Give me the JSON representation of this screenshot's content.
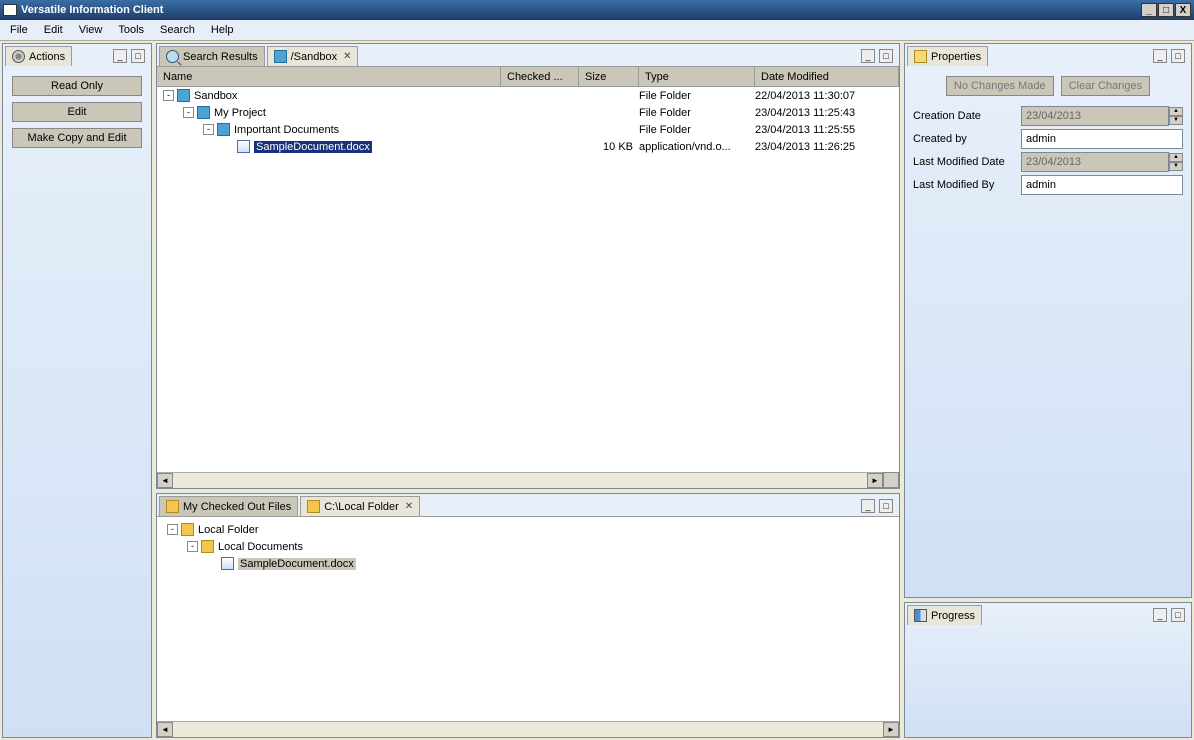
{
  "title": "Versatile Information Client",
  "menus": [
    "File",
    "Edit",
    "View",
    "Tools",
    "Search",
    "Help"
  ],
  "actions": {
    "title": "Actions",
    "buttons": [
      "Read Only",
      "Edit",
      "Make Copy and Edit"
    ]
  },
  "tabs": {
    "search": "Search Results",
    "sandbox": "/Sandbox"
  },
  "columns": {
    "name": "Name",
    "checked": "Checked ...",
    "size": "Size",
    "type": "Type",
    "date": "Date Modified"
  },
  "tree": [
    {
      "level": 1,
      "exp": "-",
      "icon": "folder",
      "name": "Sandbox",
      "size": "",
      "type": "File Folder",
      "date": "22/04/2013 11:30:07"
    },
    {
      "level": 2,
      "exp": "-",
      "icon": "folder",
      "name": "My Project",
      "size": "",
      "type": "File Folder",
      "date": "23/04/2013 11:25:43"
    },
    {
      "level": 3,
      "exp": "-",
      "icon": "folder",
      "name": "Important Documents",
      "size": "",
      "type": "File Folder",
      "date": "23/04/2013 11:25:55"
    },
    {
      "level": 4,
      "exp": "",
      "icon": "doc",
      "name": "SampleDocument.docx",
      "size": "10 KB",
      "type": "application/vnd.o...",
      "date": "23/04/2013 11:26:25",
      "selected": true
    }
  ],
  "local": {
    "tab_checked": "My Checked Out Files",
    "tab_path": "C:\\Local Folder",
    "tree": [
      {
        "level": 1,
        "exp": "-",
        "icon": "folder-y",
        "name": "Local Folder"
      },
      {
        "level": 2,
        "exp": "-",
        "icon": "folder-y",
        "name": "Local Documents"
      },
      {
        "level": 3,
        "exp": "",
        "icon": "doc",
        "name": "SampleDocument.docx",
        "selected": true
      }
    ]
  },
  "properties": {
    "title": "Properties",
    "btn_nochange": "No Changes Made",
    "btn_clear": "Clear Changes",
    "creation_date_label": "Creation Date",
    "creation_date": "23/04/2013",
    "created_by_label": "Created by",
    "created_by": "admin",
    "modified_date_label": "Last Modified Date",
    "modified_date": "23/04/2013",
    "modified_by_label": "Last Modified By",
    "modified_by": "admin"
  },
  "progress": {
    "title": "Progress"
  }
}
